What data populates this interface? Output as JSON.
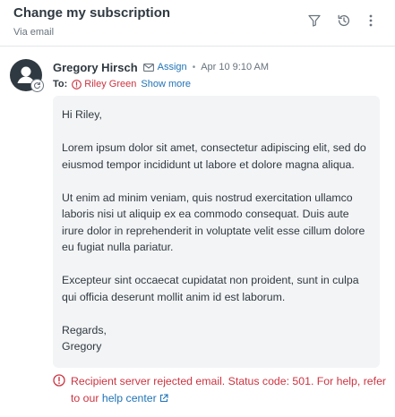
{
  "header": {
    "title": "Change my subscription",
    "subtitle": "Via email",
    "icons": [
      "filter-icon",
      "history-icon",
      "more-options-icon"
    ]
  },
  "message": {
    "sender": "Gregory Hirsch",
    "assign_label": "Assign",
    "separator": "•",
    "timestamp": "Apr 10 9:10 AM",
    "to_label": "To:",
    "recipient": "Riley Green",
    "show_more_label": "Show more",
    "body": {
      "greeting": "Hi Riley,",
      "paragraph1": "Lorem ipsum dolor sit amet, consectetur adipiscing elit, sed do eiusmod tempor incididunt ut labore et dolore magna aliqua.",
      "paragraph2": "Ut enim ad minim veniam, quis nostrud exercitation ullamco laboris nisi ut aliquip ex ea commodo consequat. Duis aute irure dolor in reprehenderit in voluptate velit esse cillum dolore eu fugiat nulla pariatur.",
      "paragraph3": "Excepteur sint occaecat cupidatat non proident, sunt in culpa qui officia deserunt mollit anim id est laborum.",
      "signoff": "Regards,",
      "signature": "Gregory"
    }
  },
  "error": {
    "text": "Recipient server rejected email. Status code: 501. For help, refer to our",
    "link_label": "help center"
  },
  "colors": {
    "error": "#cc3340",
    "link": "#1f73b7",
    "text": "#2f3941",
    "muted": "#68737d",
    "bubble": "#f3f4f5"
  }
}
